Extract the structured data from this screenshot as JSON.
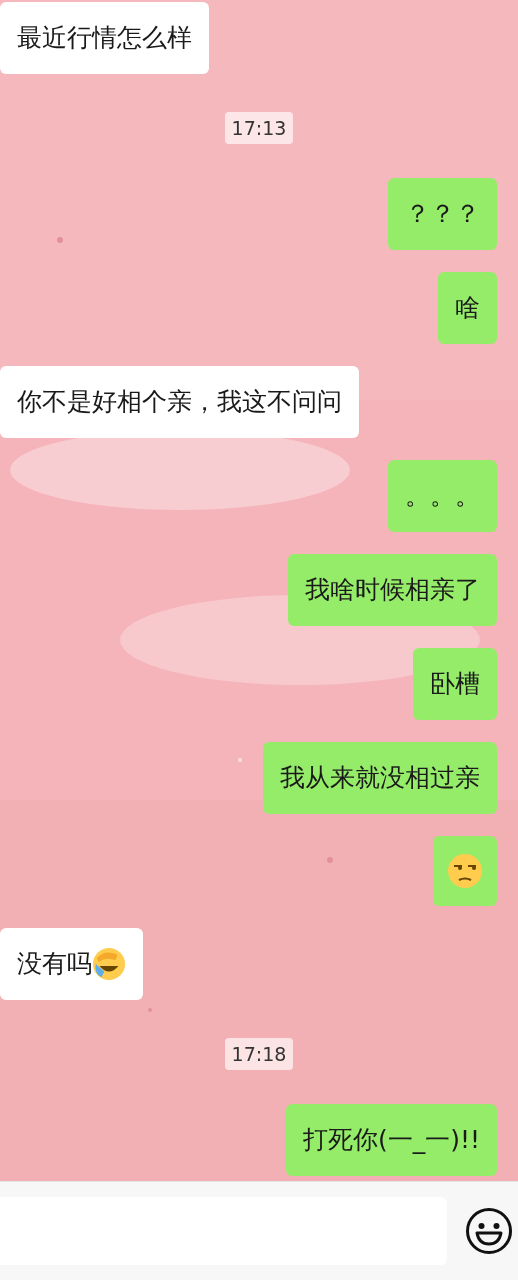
{
  "messages": [
    {
      "kind": "text",
      "outgoing": false,
      "text": "最近行情怎么样"
    },
    {
      "kind": "time",
      "text": "17:13"
    },
    {
      "kind": "text",
      "outgoing": true,
      "text": "？？？"
    },
    {
      "kind": "text",
      "outgoing": true,
      "text": "啥"
    },
    {
      "kind": "text",
      "outgoing": false,
      "text": "你不是好相个亲，我这不问问"
    },
    {
      "kind": "text",
      "outgoing": true,
      "text": "。。。"
    },
    {
      "kind": "text",
      "outgoing": true,
      "text": "我啥时候相亲了"
    },
    {
      "kind": "text",
      "outgoing": true,
      "text": "卧槽"
    },
    {
      "kind": "text",
      "outgoing": true,
      "text": "我从来就没相过亲"
    },
    {
      "kind": "sticker",
      "outgoing": true
    },
    {
      "kind": "text_emoji",
      "outgoing": false,
      "text": "没有吗"
    },
    {
      "kind": "time",
      "text": "17:18"
    },
    {
      "kind": "text",
      "outgoing": true,
      "text": "打死你(一_一)!!"
    }
  ]
}
